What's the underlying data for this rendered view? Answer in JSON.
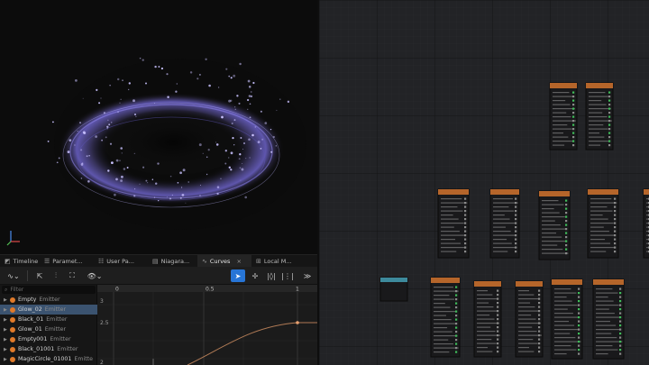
{
  "tabs": [
    {
      "label": "Timeline",
      "icon": "timeline-icon"
    },
    {
      "label": "Paramet...",
      "icon": "parameters-icon"
    },
    {
      "label": "User Pa...",
      "icon": "user-parameters-icon"
    },
    {
      "label": "Niagara...",
      "icon": "niagara-log-icon"
    },
    {
      "label": "Curves",
      "icon": "curves-icon",
      "active": true,
      "close": "×"
    },
    {
      "label": "Local M...",
      "icon": "local-modules-icon"
    }
  ],
  "toolbar": {
    "curve_dropdown": "∿⌄",
    "view_dropdown": "👁⌄",
    "more": "≫"
  },
  "filter": {
    "placeholder": "Filter"
  },
  "emitters": [
    {
      "name": "Empty",
      "suffix": "Emitter"
    },
    {
      "name": "Glow_02",
      "suffix": "Emitter",
      "selected": true
    },
    {
      "name": "Black_01",
      "suffix": "Emitter"
    },
    {
      "name": "Glow_01",
      "suffix": "Emitter"
    },
    {
      "name": "Empty001",
      "suffix": "Emitter"
    },
    {
      "name": "Black_01001",
      "suffix": "Emitter"
    },
    {
      "name": "MagicCircle_01001",
      "suffix": "Emitte"
    }
  ],
  "curve_axis": {
    "x_ticks": [
      "0",
      "0.5",
      "1"
    ],
    "y_ticks": [
      "3",
      "2.5",
      "2"
    ]
  },
  "colors": {
    "accent": "#2775d6",
    "selected_row": "#3b5370",
    "emitter_dot": "#e07a2a",
    "node_header": "#b5652a",
    "node_header_input": "#3d8a9c",
    "curve": "#b07a55",
    "particles": "#7a6cff"
  }
}
